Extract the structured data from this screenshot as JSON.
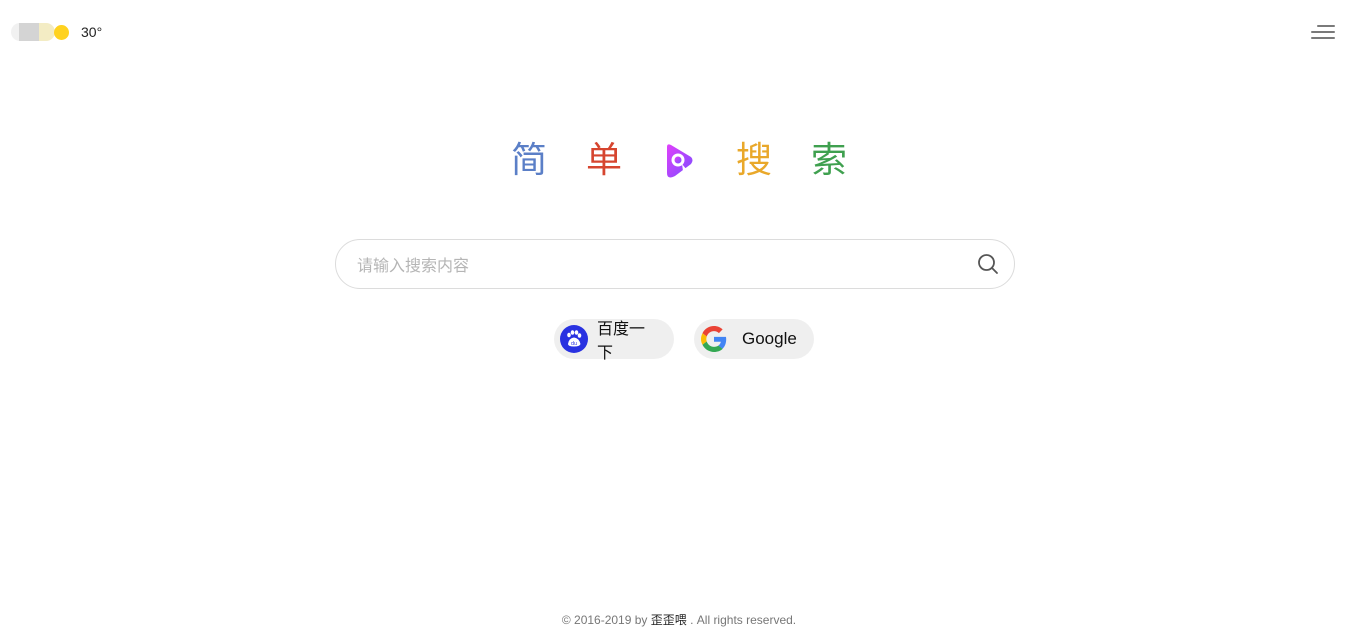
{
  "weather": {
    "icon": "partly-cloudy-sun-icon",
    "temperature": "30°",
    "sun_color": "#ffd21f"
  },
  "header": {
    "menu_icon": "hamburger-menu-icon"
  },
  "logo": {
    "chars": [
      {
        "text": "简",
        "color": "#5b7fc7"
      },
      {
        "text": "单",
        "color": "#d6452f"
      },
      {
        "text": "搜",
        "color": "#e9a82a"
      },
      {
        "text": "索",
        "color": "#3fa04f"
      }
    ],
    "mark_icon": "play-search-logo-icon",
    "mark_colors": [
      "#e040fb",
      "#7c4dff"
    ]
  },
  "search": {
    "placeholder": "请输入搜索内容",
    "value": "",
    "button_icon": "search-icon"
  },
  "engines": [
    {
      "label": "百度一下",
      "icon": "baidu-paw-icon",
      "color": "#2932e1"
    },
    {
      "label": "Google",
      "icon": "google-g-icon",
      "colors": [
        "#4285F4",
        "#EA4335",
        "#FBBC05",
        "#34A853"
      ]
    }
  ],
  "footer": {
    "prefix": "© 2016-2019 by ",
    "author": "歪歪喂",
    "suffix": " . All rights reserved."
  }
}
